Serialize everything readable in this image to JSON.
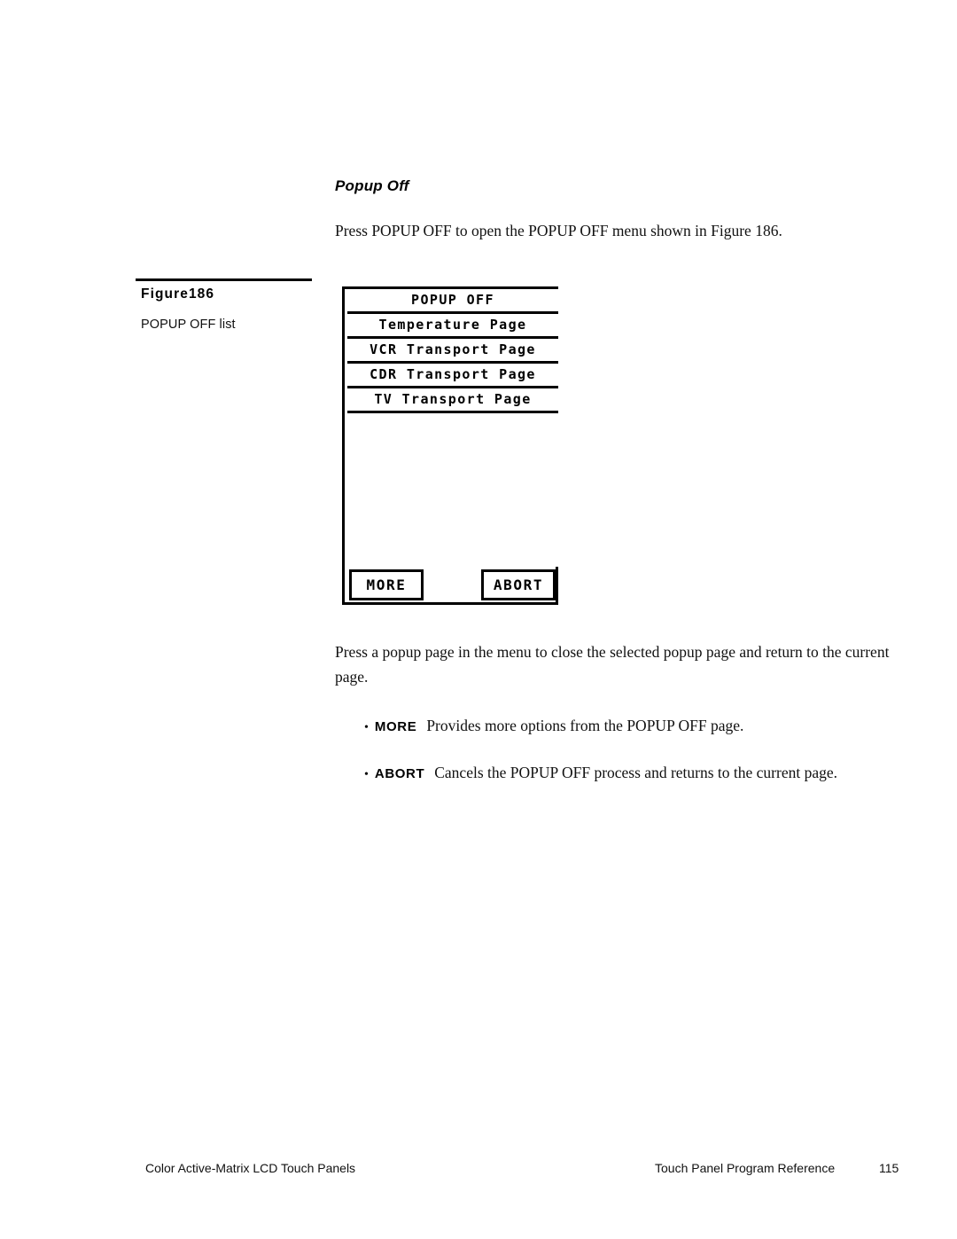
{
  "section": {
    "heading": "Popup Off",
    "intro_paragraph": "Press POPUP OFF to open the POPUP OFF menu shown in Figure 186.",
    "explanation_paragraph": "Press a popup page in the menu to close the selected popup page and return to the current page."
  },
  "figure": {
    "number_label": "Figure186",
    "description": "POPUP OFF list",
    "panel": {
      "title": "POPUP OFF",
      "list_items": [
        "Temperature Page",
        "VCR Transport Page",
        "CDR Transport Page",
        "TV Transport Page"
      ],
      "buttons": {
        "more": "MORE",
        "abort": "ABORT"
      }
    }
  },
  "bullets": [
    {
      "marker": "•",
      "term": "MORE",
      "description": "Provides more options from the POPUP OFF page."
    },
    {
      "marker": "•",
      "term": "ABORT",
      "description": "Cancels the POPUP OFF process and returns to the current page."
    }
  ],
  "footer": {
    "left": "Color Active-Matrix LCD Touch Panels",
    "right": "Touch Panel Program Reference",
    "page_number": "115"
  }
}
